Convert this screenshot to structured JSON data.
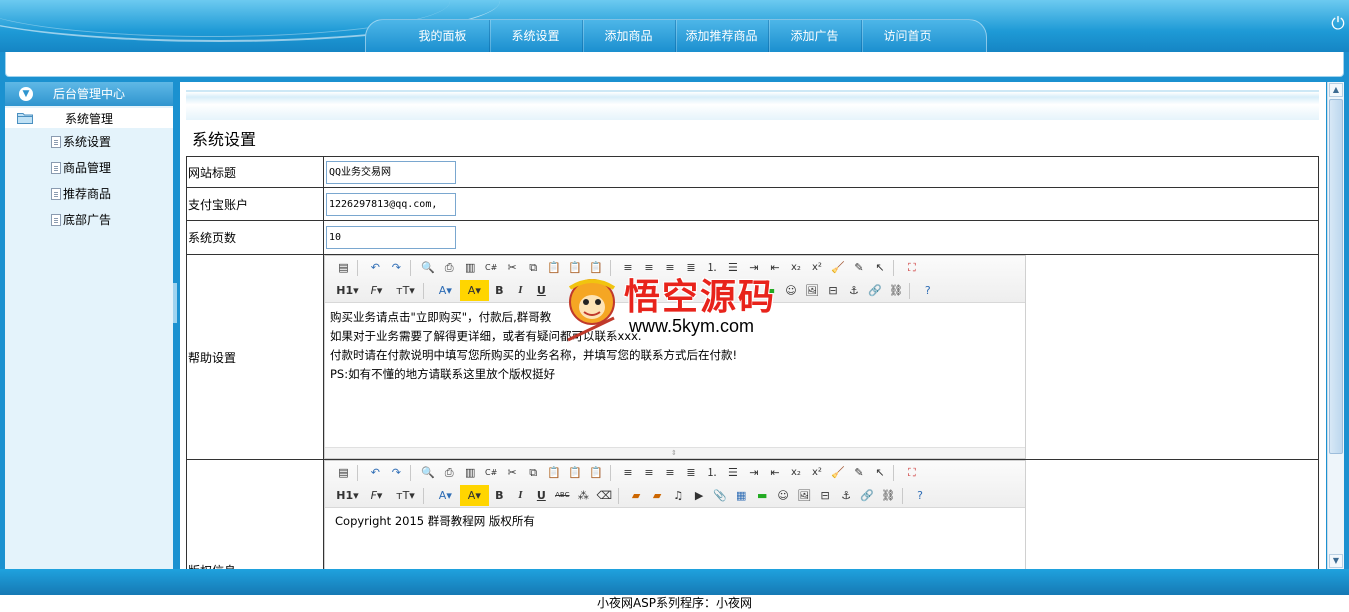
{
  "nav": {
    "items": [
      "我的面板",
      "系统设置",
      "添加商品",
      "添加推荐商品",
      "添加广告",
      "访问首页"
    ]
  },
  "sidebar": {
    "header": "后台管理中心",
    "group": "系统管理",
    "items": [
      "系统设置",
      "商品管理",
      "推荐商品",
      "底部广告"
    ]
  },
  "main": {
    "title": "系统设置",
    "fields": {
      "site_title": {
        "label": "网站标题",
        "value": "QQ业务交易网"
      },
      "alipay": {
        "label": "支付宝账户",
        "value": "1226297813@qq.com,"
      },
      "page_count": {
        "label": "系统页数",
        "value": "10"
      },
      "help": {
        "label": "帮助设置",
        "lines": [
          "购买业务请点击\"立即购买\"，付款后,群哥教",
          "如果对于业务需要了解得更详细，或者有疑问都可以联系xxx.",
          "付款时请在付款说明中填写您所购买的业务名称，并填写您的联系方式后在付款!",
          "PS:如有不懂的地方请联系这里放个版权挺好"
        ]
      },
      "copyright": {
        "label": "版权信息",
        "content": "Copyright  2015  群哥教程网 版权所有"
      }
    }
  },
  "watermark": {
    "title": "悟空源码",
    "url": "www.5kym.com"
  },
  "footer": {
    "text": "小夜网ASP系列程序：小夜网"
  },
  "colors": {
    "frame_blue": "#1b91d0",
    "sidebar_bg": "#e4f3fb",
    "watermark_red": "#e8231b"
  }
}
